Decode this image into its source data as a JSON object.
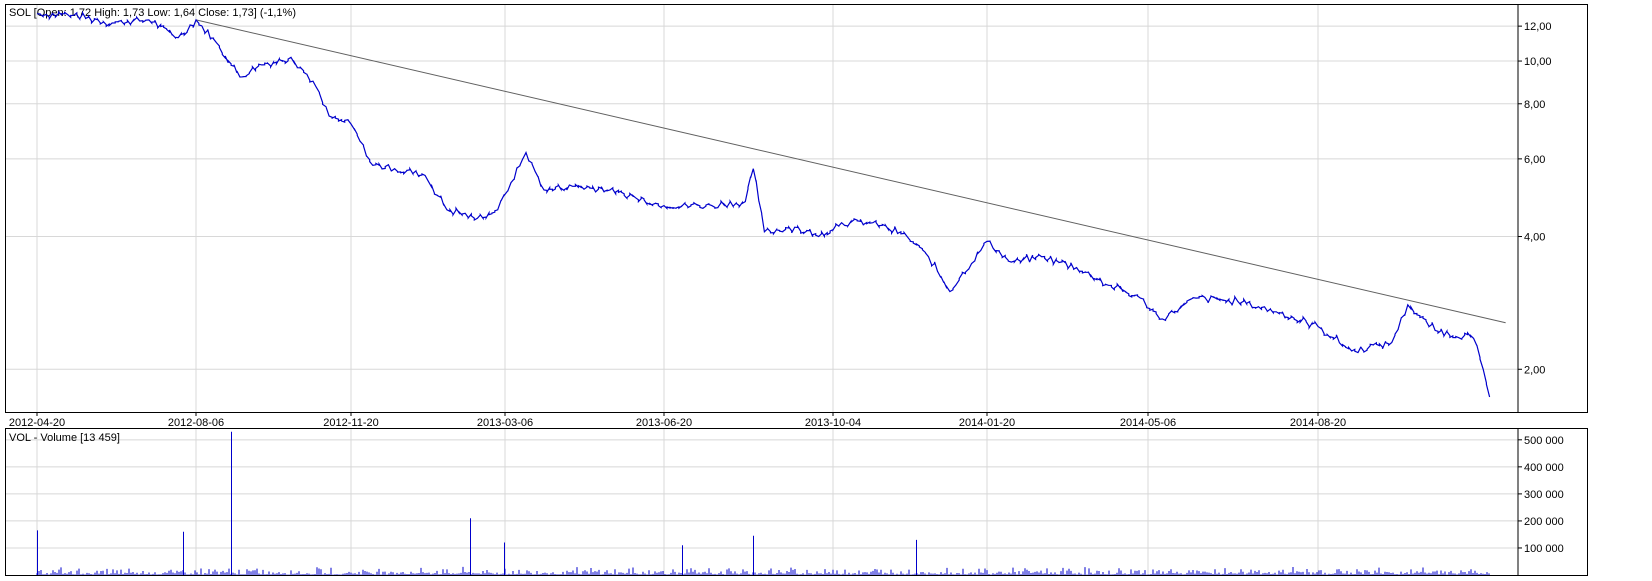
{
  "colors": {
    "price": "#0000cc",
    "volume": "#0000cc",
    "trendline": "#606060",
    "grid": "#d8d8d8",
    "background": "#ffffff"
  },
  "price_panel": {
    "header": "SOL [Open: 1,72  High: 1,73  Low: 1,64  Close: 1,73] (-1,1%)",
    "y_ticks": [
      "12,00",
      "10,00",
      "8,00",
      "6,00",
      "4,00",
      "2,00"
    ],
    "x_ticks": [
      "2012-04-20",
      "2012-08-06",
      "2012-11-20",
      "2013-03-06",
      "2013-06-20",
      "2013-10-04",
      "2014-01-20",
      "2014-05-06",
      "2014-08-20"
    ]
  },
  "volume_panel": {
    "header": "VOL - Volume [13 459]",
    "y_ticks": [
      "500 000",
      "400 000",
      "300 000",
      "200 000",
      "100 000"
    ]
  },
  "chart_data": [
    {
      "type": "line",
      "title": "SOL [Open: 1,72  High: 1,73  Low: 1,64  Close: 1,73] (-1,1%)",
      "scale": "log",
      "x_tick_labels": [
        "2012-04-20",
        "2012-08-06",
        "2012-11-20",
        "2013-03-06",
        "2013-06-20",
        "2013-10-04",
        "2014-01-20",
        "2014-05-06",
        "2014-08-20"
      ],
      "ylim": [
        1.6,
        13.4
      ],
      "grid": true,
      "series": [
        {
          "values_approx_close": [
            [
              "2012-04-20",
              12.8
            ],
            [
              "2012-05-15",
              12.7
            ],
            [
              "2012-06-10",
              12.2
            ],
            [
              "2012-07-05",
              12.4
            ],
            [
              "2012-07-25",
              11.3
            ],
            [
              "2012-08-06",
              12.4
            ],
            [
              "2012-08-20",
              11.0
            ],
            [
              "2012-09-05",
              9.2
            ],
            [
              "2012-09-20",
              9.8
            ],
            [
              "2012-10-10",
              10.2
            ],
            [
              "2012-10-25",
              9.0
            ],
            [
              "2012-11-05",
              7.5
            ],
            [
              "2012-11-20",
              7.2
            ],
            [
              "2012-12-05",
              5.8
            ],
            [
              "2012-12-20",
              5.7
            ],
            [
              "2013-01-10",
              5.5
            ],
            [
              "2013-01-25",
              4.6
            ],
            [
              "2013-02-15",
              4.4
            ],
            [
              "2013-03-01",
              4.6
            ],
            [
              "2013-03-10",
              5.3
            ],
            [
              "2013-03-20",
              6.2
            ],
            [
              "2013-04-01",
              5.1
            ],
            [
              "2013-04-20",
              5.2
            ],
            [
              "2013-05-15",
              5.1
            ],
            [
              "2013-06-01",
              4.9
            ],
            [
              "2013-06-20",
              4.7
            ],
            [
              "2013-07-20",
              4.7
            ],
            [
              "2013-08-10",
              4.8
            ],
            [
              "2013-08-15",
              5.7
            ],
            [
              "2013-08-22",
              4.1
            ],
            [
              "2013-09-10",
              4.2
            ],
            [
              "2013-09-25",
              4.0
            ],
            [
              "2013-10-10",
              4.3
            ],
            [
              "2013-11-01",
              4.3
            ],
            [
              "2013-11-25",
              4.0
            ],
            [
              "2013-12-10",
              3.6
            ],
            [
              "2013-12-25",
              3.0
            ],
            [
              "2014-01-20",
              3.9
            ],
            [
              "2014-02-05",
              3.5
            ],
            [
              "2014-02-25",
              3.6
            ],
            [
              "2014-03-20",
              3.4
            ],
            [
              "2014-04-10",
              3.1
            ],
            [
              "2014-05-01",
              2.9
            ],
            [
              "2014-05-15",
              2.6
            ],
            [
              "2014-06-05",
              2.9
            ],
            [
              "2014-07-01",
              2.85
            ],
            [
              "2014-07-25",
              2.7
            ],
            [
              "2014-08-20",
              2.5
            ],
            [
              "2014-09-10",
              2.2
            ],
            [
              "2014-10-05",
              2.3
            ],
            [
              "2014-10-15",
              2.8
            ],
            [
              "2014-11-01",
              2.45
            ],
            [
              "2014-11-25",
              2.35
            ],
            [
              "2014-12-01",
              2.0
            ],
            [
              "2014-12-05",
              1.73
            ]
          ]
        }
      ],
      "trendline": {
        "from": [
          "2012-08-06",
          12.4
        ],
        "to": [
          "2014-12-15",
          2.55
        ]
      }
    },
    {
      "type": "bar",
      "title": "VOL - Volume [13 459]",
      "ylim": [
        0,
        540000
      ],
      "grid": true,
      "series": [
        {
          "notable_spikes": [
            [
              "2012-04-20",
              165000
            ],
            [
              "2012-07-28",
              160000
            ],
            [
              "2012-08-30",
              530000
            ],
            [
              "2013-02-10",
              210000
            ],
            [
              "2013-03-05",
              120000
            ],
            [
              "2013-07-01",
              110000
            ],
            [
              "2013-08-15",
              145000
            ],
            [
              "2013-12-01",
              130000
            ]
          ]
        }
      ]
    }
  ]
}
